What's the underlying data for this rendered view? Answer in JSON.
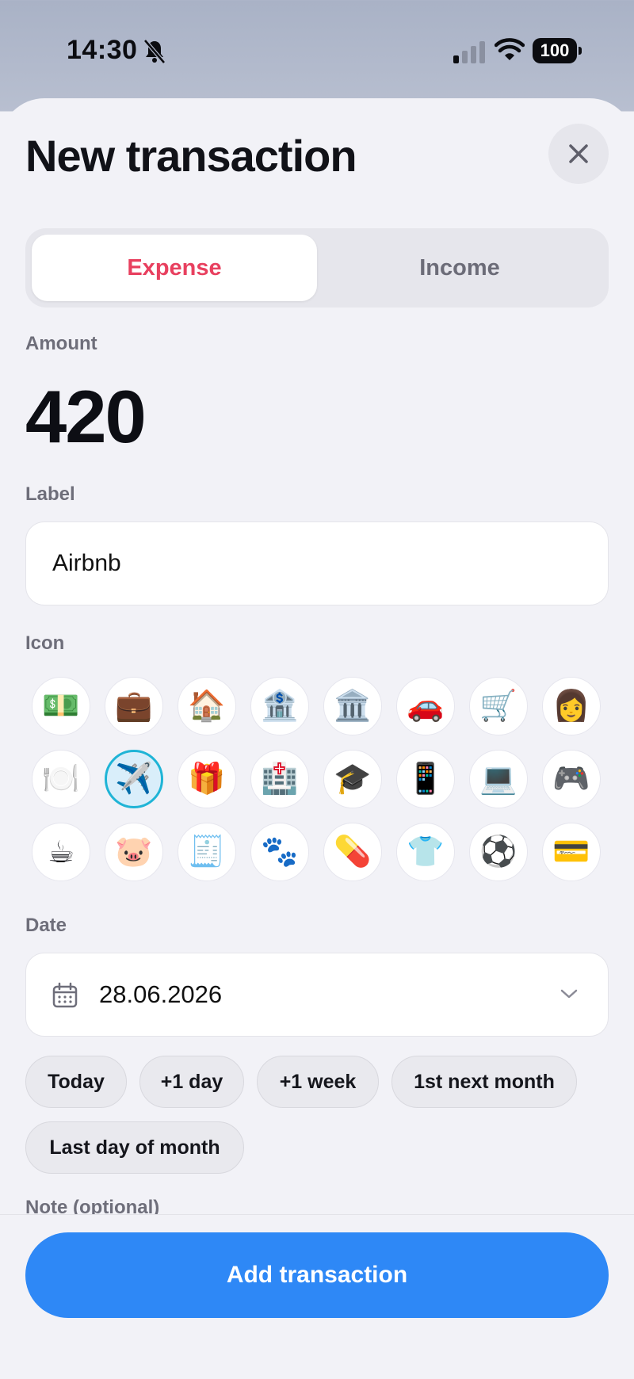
{
  "status_bar": {
    "time": "14:30",
    "battery": "100"
  },
  "sheet": {
    "title": "New transaction"
  },
  "type_segment": {
    "expense": "Expense",
    "income": "Income",
    "selected": "Expense"
  },
  "amount": {
    "label": "Amount",
    "value": "420"
  },
  "label_field": {
    "label": "Label",
    "value": "Airbnb"
  },
  "icons": {
    "label": "Icon",
    "items": [
      "💵",
      "💼",
      "🏠",
      "🏦",
      "🏛️",
      "🚗",
      "🛒",
      "👩",
      "🍽️",
      "✈️",
      "🎁",
      "🏥",
      "🎓",
      "📱",
      "💻",
      "🎮",
      "☕",
      "🐷",
      "🧾",
      "🐾",
      "💊",
      "👕",
      "⚽",
      "💳"
    ],
    "selected_index": 9
  },
  "date": {
    "label": "Date",
    "value": "28.06.2026"
  },
  "date_shortcuts": [
    "Today",
    "+1 day",
    "+1 week",
    "1st next month",
    "Last day of month"
  ],
  "note": {
    "label": "Note (optional)"
  },
  "submit": {
    "label": "Add transaction"
  },
  "colors": {
    "accent": "#2e88f6",
    "expense": "#e8405f",
    "selected_icon_border": "#1fb4d6"
  }
}
